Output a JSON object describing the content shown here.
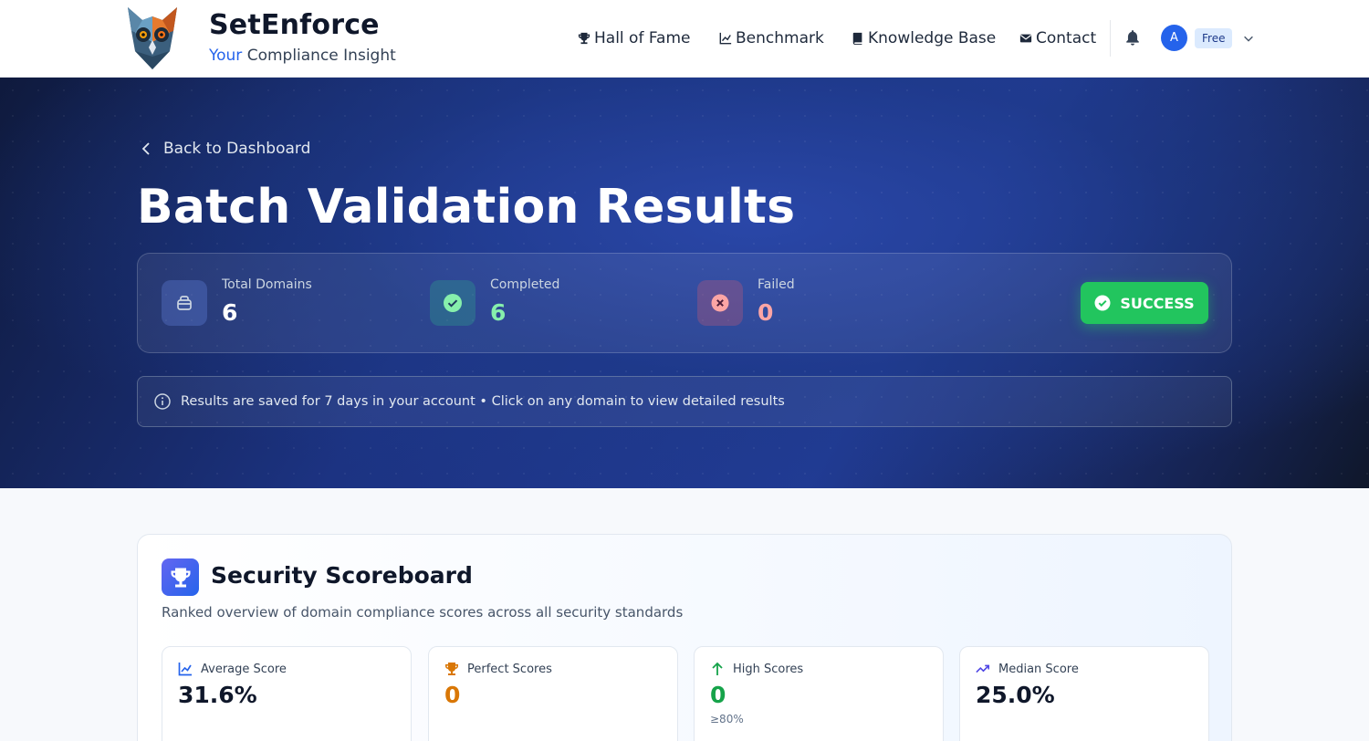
{
  "brand": {
    "name": "SetEnforce",
    "tag_accent": "Your",
    "tag_rest": " Compliance Insight"
  },
  "nav": [
    {
      "label": "Hall of Fame",
      "icon": "trophy-icon"
    },
    {
      "label": "Benchmark",
      "icon": "chart-line-icon"
    },
    {
      "label": "Knowledge Base",
      "icon": "book-icon"
    },
    {
      "label": "Contact",
      "icon": "envelope-icon"
    }
  ],
  "user": {
    "avatar": "A",
    "plan": "Free"
  },
  "hero": {
    "back_label": "Back to Dashboard",
    "title": "Batch Validation Results",
    "stats": [
      {
        "label": "Total Domains",
        "value": "6"
      },
      {
        "label": "Completed",
        "value": "6"
      },
      {
        "label": "Failed",
        "value": "0"
      }
    ],
    "status": "SUCCESS",
    "info": "Results are saved for 7 days in your account • Click on any domain to view detailed results"
  },
  "scoreboard": {
    "title": "Security Scoreboard",
    "subtitle": "Ranked overview of domain compliance scores across all security standards",
    "cards": [
      {
        "label": "Average Score",
        "value": "31.6%",
        "note": ""
      },
      {
        "label": "Perfect Scores",
        "value": "0",
        "note": ""
      },
      {
        "label": "High Scores",
        "value": "0",
        "note": "≥80%"
      },
      {
        "label": "Median Score",
        "value": "25.0%",
        "note": ""
      }
    ]
  },
  "colors": {
    "accent": "#2563eb",
    "success": "#22c55e",
    "completed": "#86efac",
    "failed": "#fca5a5",
    "perfect": "#d97706",
    "high": "#16a34a"
  }
}
